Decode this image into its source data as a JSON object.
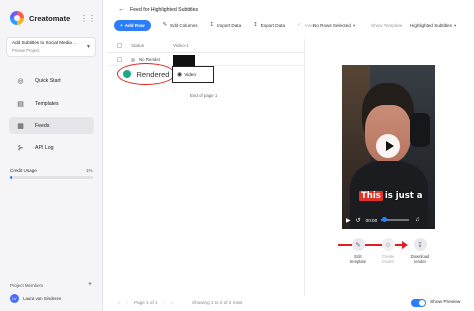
{
  "app": {
    "name": "Creatomate"
  },
  "project": {
    "title": "Add Subtitles to Social Media ...",
    "subtitle": "Private Project"
  },
  "nav": [
    {
      "label": "Quick Start",
      "icon": "play-circle-icon"
    },
    {
      "label": "Templates",
      "icon": "templates-icon"
    },
    {
      "label": "Feeds",
      "icon": "feeds-icon",
      "active": true
    },
    {
      "label": "API Log",
      "icon": "share-icon"
    }
  ],
  "credit": {
    "label": "Credit Usage",
    "percent": "1%",
    "fraction": 0.01
  },
  "members": {
    "label": "Project Members",
    "user_initials": "LV",
    "user_name": "Laura van Sinderen"
  },
  "header": {
    "title": "Feed for Highlighted Subtitles"
  },
  "toolbar": {
    "add_row": "Add Row",
    "edit_columns": "Edit Columns",
    "import_data": "Import Data",
    "export_data": "Export Data",
    "view": "View",
    "rows_selected": "No Rows Selected",
    "show_template": "Show Template",
    "template_name": "Highlighted Subtitles"
  },
  "table": {
    "headers": {
      "status": "Status",
      "video": "Video-1"
    },
    "rows": [
      {
        "status": "No Render",
        "status_color": "#bdbdbd"
      },
      {
        "status": "Rendered",
        "status_color": "#1ea98a",
        "video_label": "Video"
      }
    ],
    "end_text": "End of page 1"
  },
  "footer": {
    "page": "Page 1 of 1",
    "showing": "Showing 1 to 2 of 2 rows",
    "show_preview": "Show Preview"
  },
  "preview": {
    "subtitle_highlight": "This",
    "subtitle_rest": "is just a",
    "time": "00:00",
    "progress": 0.1
  },
  "actions": [
    {
      "label_1": "Edit",
      "label_2": "template"
    },
    {
      "label_1": "Create",
      "label_2": "render"
    },
    {
      "label_1": "Download",
      "label_2": "render"
    }
  ],
  "colors": {
    "accent": "#2d7dfa",
    "annotation": "#e02020",
    "rendered": "#1ea98a"
  }
}
